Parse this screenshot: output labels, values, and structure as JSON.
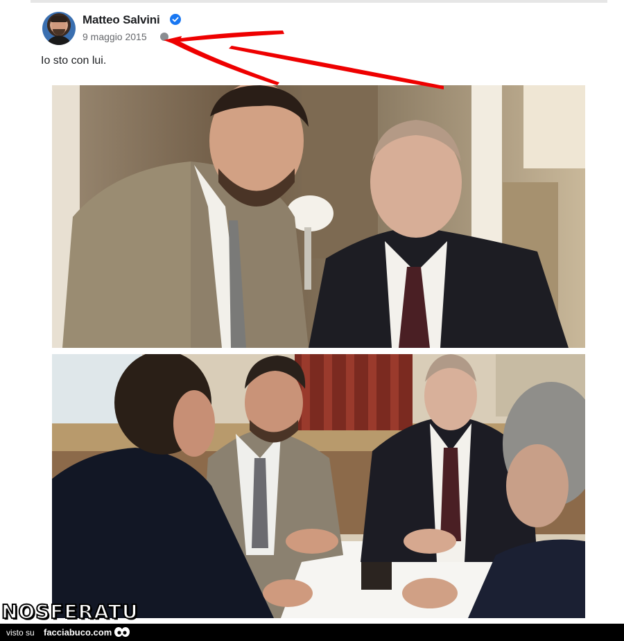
{
  "post": {
    "author": "Matteo Salvini",
    "date": "9 maggio 2015",
    "text": "Io sto con lui."
  },
  "icons": {
    "verified": "verified-badge-icon",
    "audience": "globe-icon",
    "eyes": "eyes-icon"
  },
  "watermark": {
    "text": "NOSFERATU"
  },
  "footer": {
    "seen_on": "visto su",
    "site": "facciabuco.com"
  },
  "colors": {
    "verified_blue": "#1877f2",
    "arrow_red": "#ee0000",
    "footer_bg": "#000000"
  }
}
